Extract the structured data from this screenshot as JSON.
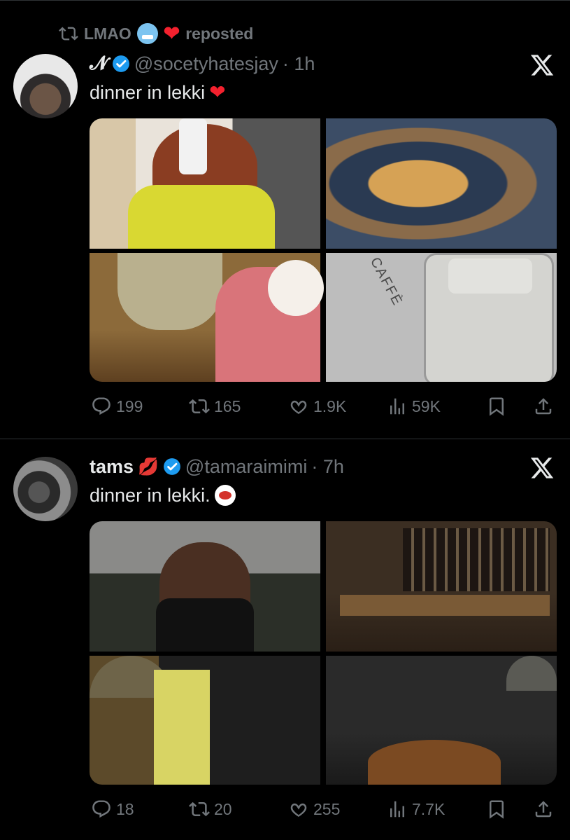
{
  "posts": [
    {
      "repost": {
        "label": "LMAO",
        "suffix": "reposted"
      },
      "user": {
        "name": "𝓝",
        "handle": "@socetyhatesjay",
        "time": "· 1h"
      },
      "text": "dinner in lekki",
      "stats": {
        "replies": "199",
        "reposts": "165",
        "likes": "1.9K",
        "views": "59K"
      },
      "photo_text": "CAFFÈ"
    },
    {
      "user": {
        "name": "tams",
        "handle": "@tamaraimimi",
        "time": "· 7h"
      },
      "text": "dinner in lekki.",
      "stats": {
        "replies": "18",
        "reposts": "20",
        "likes": "255",
        "views": "7.7K"
      }
    }
  ],
  "icons": {
    "repost": "repost-icon",
    "verified": "verified-icon",
    "x_logo": "x-logo-icon",
    "reply": "reply-icon",
    "like": "heart-icon",
    "views": "views-icon",
    "bookmark": "bookmark-icon",
    "share": "share-icon"
  },
  "colors": {
    "background": "#000000",
    "text": "#e7e9ea",
    "muted": "#71767b",
    "verified": "#1d9bf0",
    "heart": "#f4212e"
  }
}
